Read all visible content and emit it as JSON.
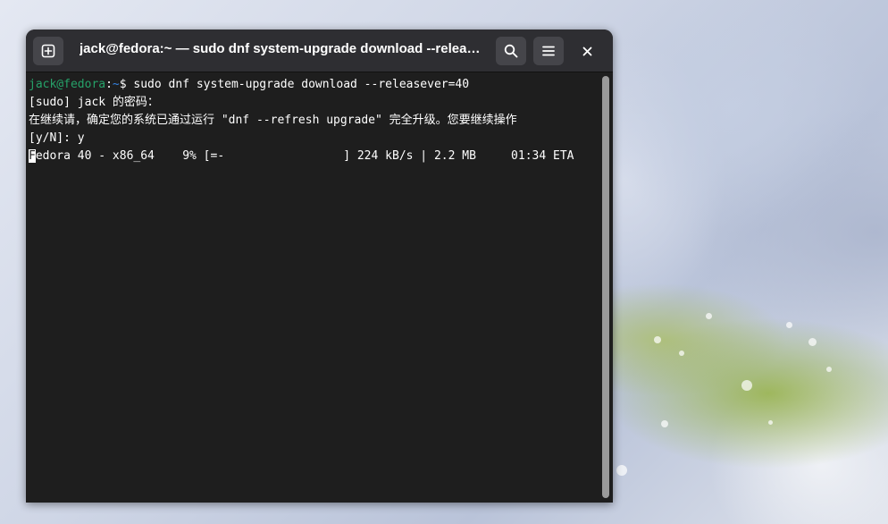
{
  "window": {
    "title": "jack@fedora:~ — sudo dnf system-upgrade download --release…",
    "buttons": {
      "new_tab_icon": "plus-square-icon",
      "search_icon": "search-icon",
      "menu_icon": "hamburger-menu-icon",
      "close_icon": "close-icon"
    }
  },
  "terminal": {
    "prompt_user": "jack@fedora",
    "prompt_sep": ":",
    "prompt_path": "~",
    "prompt_symbol": "$ ",
    "command": "sudo dnf system-upgrade download --releasever=40",
    "sudo_prompt": "[sudo] jack 的密码：",
    "confirm_line": "在继续请，确定您的系统已通过运行 \"dnf --refresh upgrade\" 完全升级。您要继续操作",
    "yn_line": "[y/N]: y",
    "progress_first_char": "F",
    "progress_rest": "edora 40 - x86_64    9% [=-                 ] 224 kB/s | 2.2 MB     01:34 ETA"
  },
  "colors": {
    "terminal_bg": "#1e1e1e",
    "headerbar_bg": "#2e2e32",
    "prompt_user": "#26a269",
    "prompt_path": "#3584e4"
  }
}
